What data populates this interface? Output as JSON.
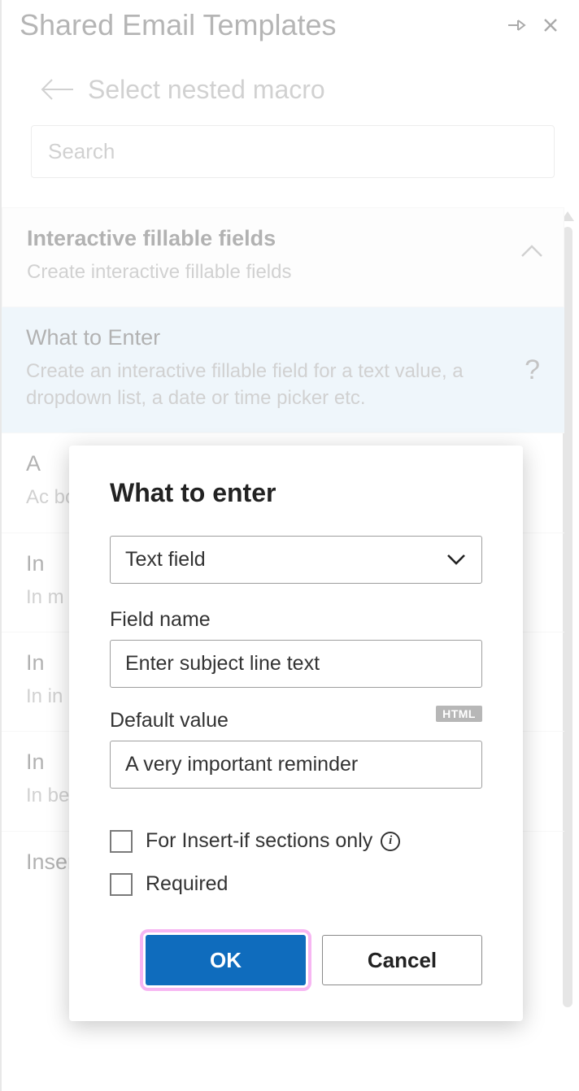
{
  "header": {
    "title": "Shared Email Templates"
  },
  "subheader": {
    "title": "Select nested macro"
  },
  "search": {
    "placeholder": "Search"
  },
  "groups": [
    {
      "title": "Interactive fillable fields",
      "desc": "Create interactive fillable fields"
    },
    {
      "title": "What to Enter",
      "desc": "Create an interactive fillable field for a text value, a dropdown list, a date or time picker etc."
    },
    {
      "title": "A",
      "desc": "Ac                                    bo"
    },
    {
      "title": "In",
      "desc": "In                                                    m                                                    th"
    },
    {
      "title": "In",
      "desc": "In                                                    in                                                    or"
    },
    {
      "title": "In",
      "desc": "In                                                    be                                                    ap"
    },
    {
      "title": "Insert Dataset value",
      "desc": ""
    }
  ],
  "dialog": {
    "title": "What to enter",
    "type_value": "Text field",
    "field_name_label": "Field name",
    "field_name_value": "Enter subject line text",
    "default_value_label": "Default value",
    "default_value_value": "A very important reminder",
    "html_badge": "HTML",
    "insertif_label": "For Insert-if sections only",
    "required_label": "Required",
    "ok": "OK",
    "cancel": "Cancel"
  }
}
